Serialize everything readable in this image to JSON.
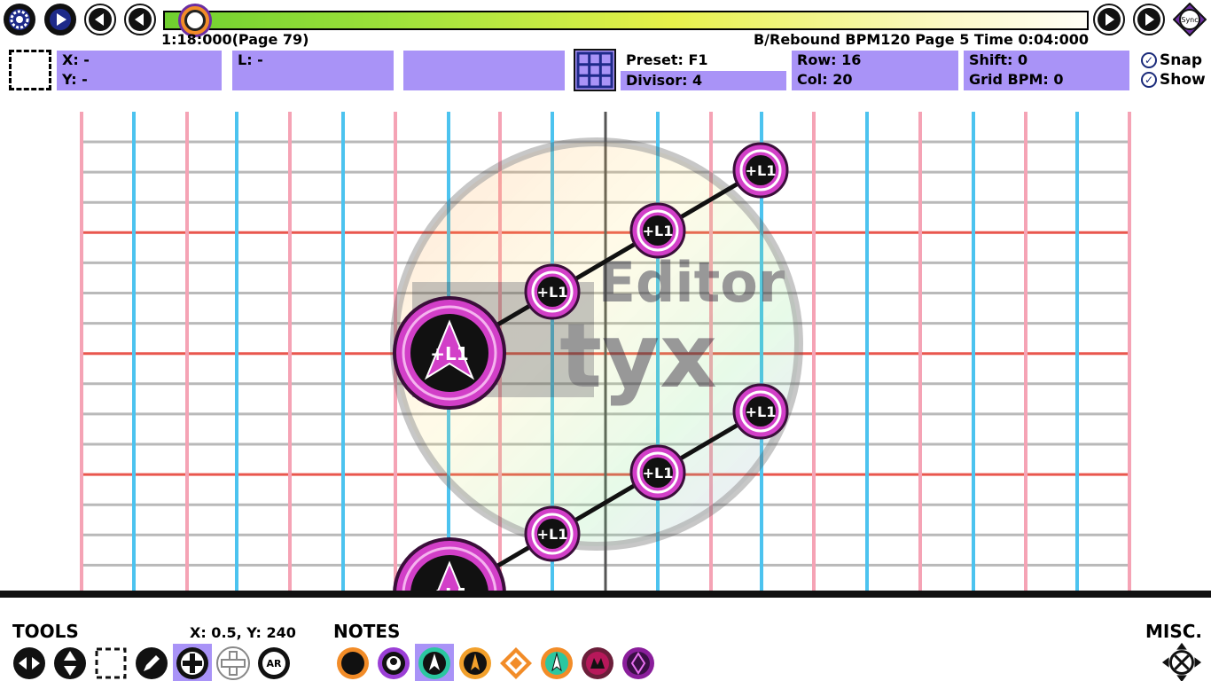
{
  "timeline": {
    "position_label": "1:18:000(Page 79)",
    "status_label": "B/Rebound  BPM120 Page 5 Time 0:04:000",
    "sync_label": "Sync"
  },
  "info": {
    "x_label": "X: -",
    "y_label": "Y: -",
    "l_label": "L: -",
    "preset_label": "Preset: F1",
    "divisor_label": "Divisor: 4",
    "row_label": "Row: 16",
    "col_label": "Col: 20",
    "shift_label": "Shift: 0",
    "grid_bpm_label": "Grid BPM: 0",
    "snap_label": "Snap",
    "show_label": "Show"
  },
  "watermark": {
    "line1": "Editor",
    "line2": "tyx"
  },
  "notes_on_grid": {
    "head_label": "+L1",
    "tick_label": "+L1"
  },
  "bottom": {
    "tools_title": "TOOLS",
    "cursor_readout": "X: 0.5, Y: 240",
    "notes_title": "NOTES",
    "misc_title": "MISC.",
    "tool_ar_label": "AR"
  },
  "colors": {
    "accent_purple": "#a993f7",
    "grid_pink": "#f5a3b5",
    "grid_blue": "#4cc3ef",
    "grid_red": "#e9574e",
    "grid_gray": "#b9b9b9",
    "note_magenta": "#d23fc8"
  }
}
